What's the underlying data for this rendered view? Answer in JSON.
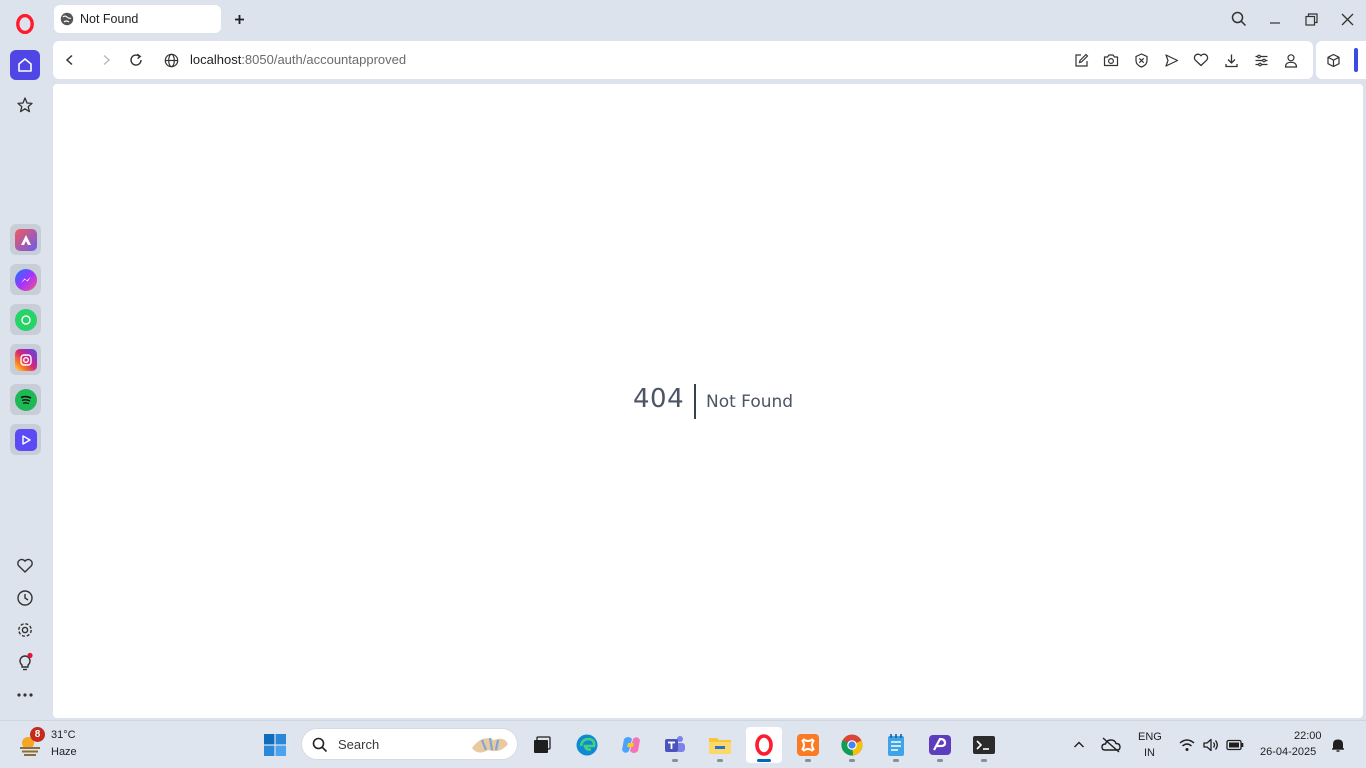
{
  "tab": {
    "title": "Not Found"
  },
  "address": {
    "host": "localhost",
    "rest": ":8050/auth/accountapproved"
  },
  "page": {
    "code": "404",
    "message": "Not Found"
  },
  "sidebar": {
    "apps": [
      "aria-icon",
      "messenger-icon",
      "whatsapp-icon",
      "instagram-icon",
      "spotify-icon",
      "player-icon"
    ],
    "bottom": [
      "heart-icon",
      "history-icon",
      "settings-icon",
      "tips-icon",
      "more-icon"
    ]
  },
  "taskbar": {
    "weather": {
      "badge": "8",
      "temp": "31°C",
      "condition": "Haze"
    },
    "search_label": "Search",
    "language": {
      "line1": "ENG",
      "line2": "IN"
    },
    "clock": {
      "time": "22:00",
      "date": "26-04-2025"
    }
  },
  "colors": {
    "accent": "#3b4ae0",
    "opera_red": "#ff1b2d",
    "page_text": "#4b5563"
  }
}
